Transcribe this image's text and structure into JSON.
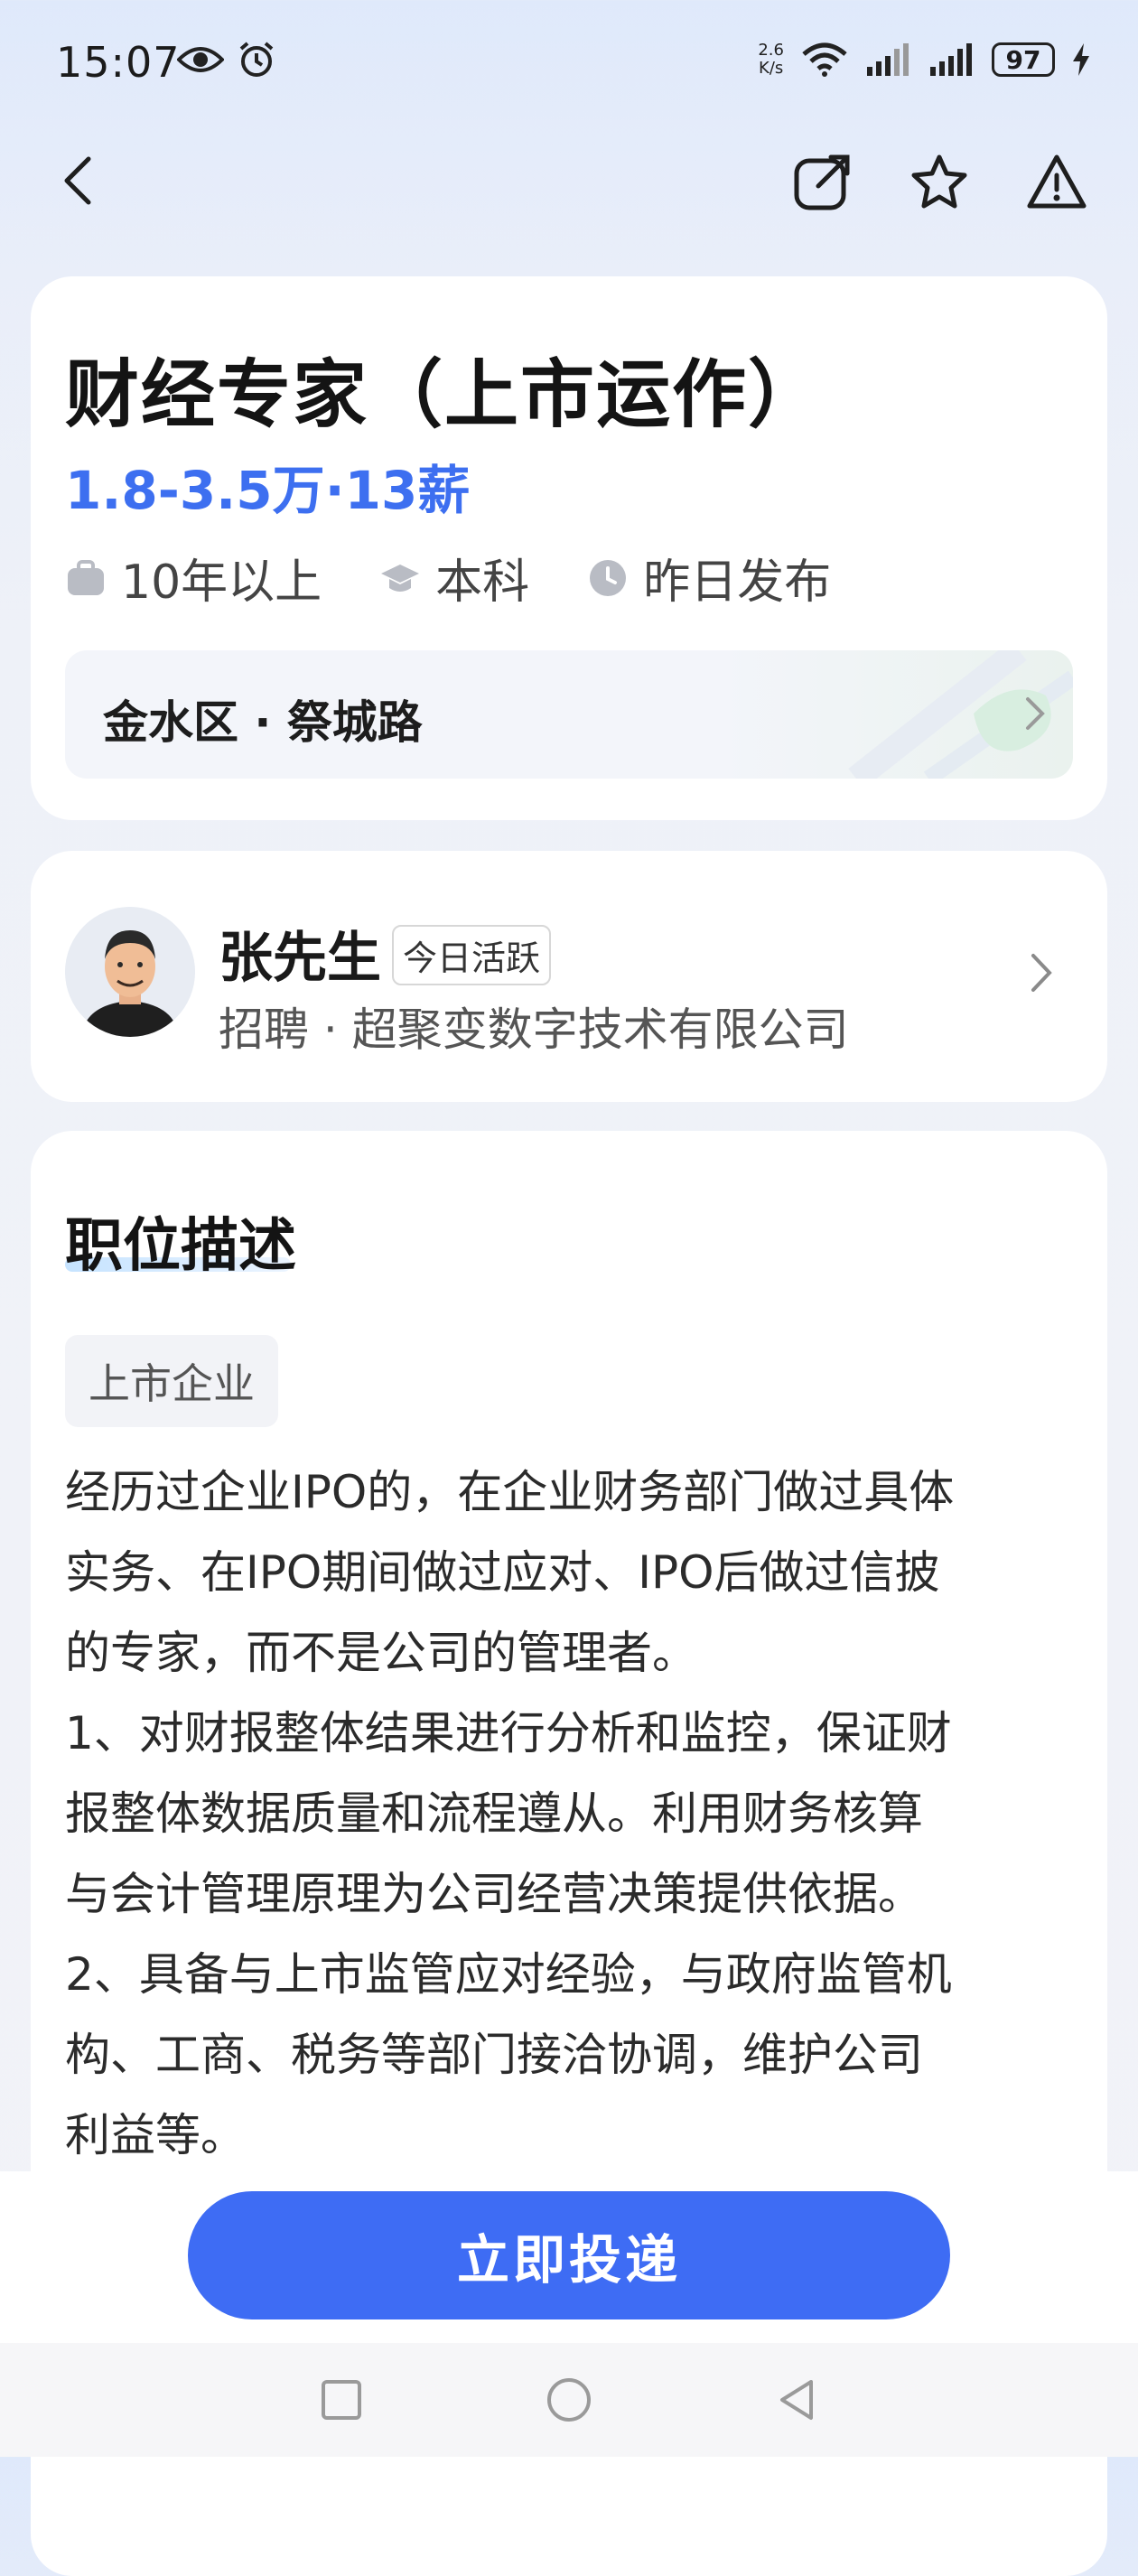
{
  "status_bar": {
    "time": "15:07",
    "net_speed_value": "2.6",
    "net_speed_unit": "K/s",
    "battery": "97"
  },
  "nav": {
    "back_icon": "chevron-left-icon",
    "share_icon": "share-icon",
    "favorite_icon": "star-icon",
    "report_icon": "warning-icon"
  },
  "job": {
    "title": "财经专家（上市运作）",
    "salary": "1.8-3.5万·13薪",
    "experience": "10年以上",
    "education": "本科",
    "posted": "昨日发布",
    "location": "金水区 · 祭城路"
  },
  "recruiter": {
    "name": "张先生",
    "badge": "今日活跃",
    "company": "招聘 · 超聚变数字技术有限公司"
  },
  "description": {
    "title": "职位描述",
    "tag": "上市企业",
    "body": "经历过企业IPO的，在企业财务部门做过具体\n实务、在IPO期间做过应对、IPO后做过信披\n的专家，而不是公司的管理者。\n1、对财报整体结果进行分析和监控，保证财\n报整体数据质量和流程遵从。利用财务核算\n与会计管理原理为公司经营决策提供依据。\n2、具备与上市监管应对经验，与政府监管机\n构、工商、税务等部门接洽协调，维护公司\n利益等。"
  },
  "footer": {
    "apply_label": "立即投递"
  },
  "colors": {
    "accent": "#3e6cf4",
    "salary": "#3d6ff0"
  }
}
